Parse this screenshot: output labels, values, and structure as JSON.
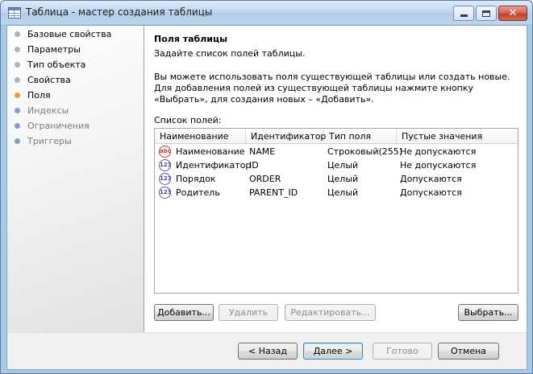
{
  "window": {
    "title": "Таблица - мастер создания таблицы",
    "minimize_glyph": "",
    "close_glyph": "✕"
  },
  "sidebar": {
    "steps": [
      {
        "label": "Базовые свойства",
        "state": "done",
        "color": "#a7b6c6"
      },
      {
        "label": "Параметры",
        "state": "done",
        "color": "#a7b6c6"
      },
      {
        "label": "Тип объекта",
        "state": "done",
        "color": "#a7b6c6"
      },
      {
        "label": "Свойства",
        "state": "done",
        "color": "#a7b6c6"
      },
      {
        "label": "Поля",
        "state": "current",
        "color": "#f29a36"
      },
      {
        "label": "Индексы",
        "state": "pending",
        "color": "#7fa0c4"
      },
      {
        "label": "Ограничения",
        "state": "pending",
        "color": "#7fa0c4"
      },
      {
        "label": "Триггеры",
        "state": "pending",
        "color": "#7fa0c4"
      }
    ]
  },
  "main": {
    "title": "Поля таблицы",
    "subtitle": "Задайте список полей таблицы.",
    "description": "Вы можете использовать поля существующей таблицы или создать новые. Для добавления полей из существующей таблицы нажмите кнопку «Выбрать», для создания новых – «Добавить».",
    "list_label": "Список полей:",
    "columns": [
      "Наименование",
      "Идентификатор",
      "Тип поля",
      "Пустые значения"
    ],
    "rows": [
      {
        "icon": "string-field-icon",
        "icon_text": "abc",
        "name": "Наименование",
        "id": "NAME",
        "type": "Строковый(255)",
        "nulls": "Не допускаются"
      },
      {
        "icon": "number-field-icon",
        "icon_text": "123",
        "name": "Идентификатор",
        "id": "ID",
        "type": "Целый",
        "nulls": "Не допускаются"
      },
      {
        "icon": "number-field-icon",
        "icon_text": "123",
        "name": "Порядок",
        "id": "ORDER",
        "type": "Целый",
        "nulls": "Допускаются"
      },
      {
        "icon": "number-field-icon",
        "icon_text": "123",
        "name": "Родитель",
        "id": "PARENT_ID",
        "type": "Целый",
        "nulls": "Допускаются"
      }
    ],
    "buttons": {
      "add": "Добавить...",
      "delete": "Удалить",
      "edit": "Редактировать...",
      "select": "Выбрать..."
    }
  },
  "footer": {
    "back": "< Назад",
    "next": "Далее >",
    "finish": "Готово",
    "cancel": "Отмена"
  },
  "colors": {
    "current_step": "#f29a36",
    "done_step": "#a7b6c6",
    "pending_step": "#7fa0c4",
    "pending_text": "#7a7a7a"
  }
}
